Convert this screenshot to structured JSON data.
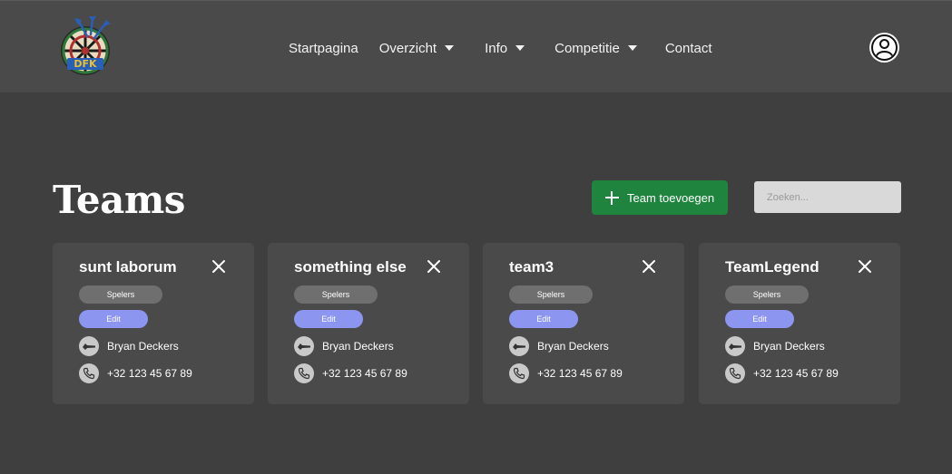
{
  "nav": {
    "logo_alt": "dartclub logo",
    "links": [
      {
        "label": "Startpagina",
        "dropdown": false
      },
      {
        "label": "Overzicht",
        "dropdown": true
      },
      {
        "label": "Info",
        "dropdown": true
      },
      {
        "label": "Competitie",
        "dropdown": true
      },
      {
        "label": "Contact",
        "dropdown": false
      }
    ],
    "user_icon": "user-circle-icon"
  },
  "page": {
    "title": "Teams",
    "add_button_label": "Team toevoegen",
    "search_placeholder": "Zoeken..."
  },
  "teams": [
    {
      "name": "sunt laborum",
      "spelers_label": "Spelers",
      "edit_label": "Edit",
      "captain": "Bryan Deckers",
      "phone": "+32 123 45 67 89"
    },
    {
      "name": "something else",
      "spelers_label": "Spelers",
      "edit_label": "Edit",
      "captain": "Bryan Deckers",
      "phone": "+32 123 45 67 89"
    },
    {
      "name": "team3",
      "spelers_label": "Spelers",
      "edit_label": "Edit",
      "captain": "Bryan Deckers",
      "phone": "+32 123 45 67 89"
    },
    {
      "name": "TeamLegend",
      "spelers_label": "Spelers",
      "edit_label": "Edit",
      "captain": "Bryan Deckers",
      "phone": "+32 123 45 67 89"
    }
  ],
  "colors": {
    "background": "#3f3f3f",
    "navbar": "#4a4a4a",
    "card": "#4a4a4a",
    "add_button": "#1e843e",
    "edit_pill": "#8c96f0",
    "spelers_pill": "#6f6f6f"
  }
}
